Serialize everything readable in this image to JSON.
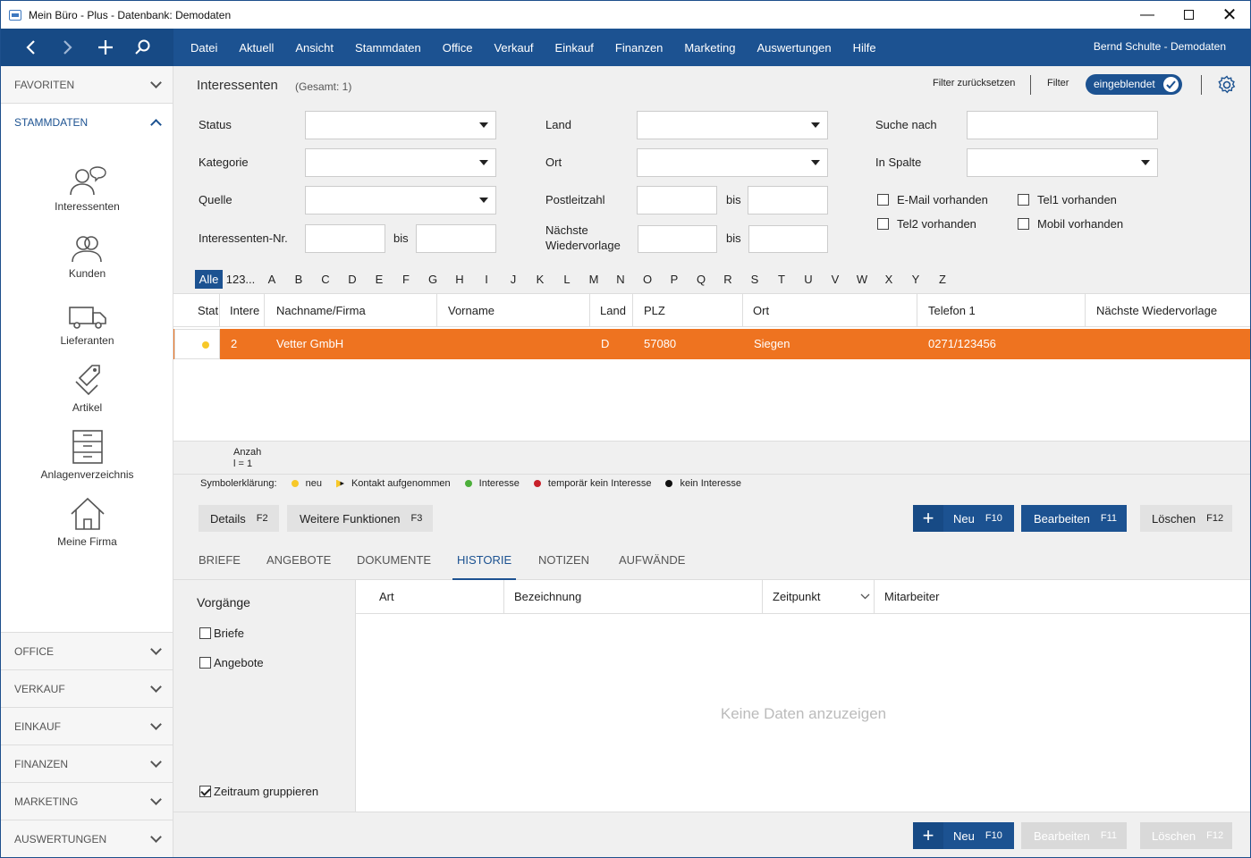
{
  "window": {
    "title": "Mein Büro - Plus - Datenbank: Demodaten"
  },
  "nav": {
    "menus": [
      "Datei",
      "Aktuell",
      "Ansicht",
      "Stammdaten",
      "Office",
      "Verkauf",
      "Einkauf",
      "Finanzen",
      "Marketing",
      "Auswertungen",
      "Hilfe"
    ],
    "user": "Bernd Schulte - Demodaten"
  },
  "sidebar": {
    "favoriten": "FAVORITEN",
    "stammdaten": "STAMMDATEN",
    "items": [
      "Interessenten",
      "Kunden",
      "Lieferanten",
      "Artikel",
      "Anlagenverzeichnis",
      "Meine Firma"
    ],
    "bottom_sections": [
      "OFFICE",
      "VERKAUF",
      "EINKAUF",
      "FINANZEN",
      "MARKETING",
      "AUSWERTUNGEN"
    ]
  },
  "header": {
    "title": "Interessenten",
    "total": "(Gesamt: 1)",
    "reset_filter": "Filter zurücksetzen",
    "filter_label": "Filter",
    "filter_toggle": "eingeblendet"
  },
  "filters": {
    "status": "Status",
    "kategorie": "Kategorie",
    "quelle": "Quelle",
    "nr": "Interessenten-Nr.",
    "bis": "bis",
    "land": "Land",
    "ort": "Ort",
    "plz": "Postleitzahl",
    "wv1": "Nächste",
    "wv2": "Wiedervorlage",
    "suche": "Suche nach",
    "spalte": "In Spalte",
    "email": "E-Mail vorhanden",
    "tel1": "Tel1 vorhanden",
    "tel2": "Tel2 vorhanden",
    "mobil": "Mobil vorhanden"
  },
  "alphabet": [
    "Alle",
    "123...",
    "A",
    "B",
    "C",
    "D",
    "E",
    "F",
    "G",
    "H",
    "I",
    "J",
    "K",
    "L",
    "M",
    "N",
    "O",
    "P",
    "Q",
    "R",
    "S",
    "T",
    "U",
    "V",
    "W",
    "X",
    "Y",
    "Z"
  ],
  "grid": {
    "columns": [
      "Stat",
      "Intere",
      "Nachname/Firma",
      "Vorname",
      "Land",
      "PLZ",
      "Ort",
      "Telefon 1",
      "Nächste Wiedervorlage"
    ],
    "rows": [
      {
        "nr": "2",
        "name": "Vetter GmbH",
        "vorname": "",
        "land": "D",
        "plz": "57080",
        "ort": "Siegen",
        "telefon": "0271/123456",
        "wiedervorlage": ""
      }
    ],
    "count_label_1": "Anzah",
    "count_label_2": "l = 1"
  },
  "legend": {
    "title": "Symbolerklärung:",
    "items": [
      {
        "label": "neu",
        "color": "#f7c829"
      },
      {
        "label": "Kontakt aufgenommen",
        "color": "#f7c829"
      },
      {
        "label": "Interesse",
        "color": "#4caf3a"
      },
      {
        "label": "temporär kein Interesse",
        "color": "#c8202a"
      },
      {
        "label": "kein Interesse",
        "color": "#111111"
      }
    ]
  },
  "actions": {
    "details": "Details",
    "details_key": "F2",
    "weitere": "Weitere Funktionen",
    "weitere_key": "F3",
    "neu": "Neu",
    "neu_key": "F10",
    "bearbeiten": "Bearbeiten",
    "bearbeiten_key": "F11",
    "loeschen": "Löschen",
    "loeschen_key": "F12"
  },
  "tabs": [
    "BRIEFE",
    "ANGEBOTE",
    "DOKUMENTE",
    "HISTORIE",
    "NOTIZEN",
    "AUFWÄNDE"
  ],
  "history": {
    "vorgaenge": "Vorgänge",
    "briefe": "Briefe",
    "angebote": "Angebote",
    "gruppieren": "Zeitraum gruppieren",
    "columns": [
      "Art",
      "Bezeichnung",
      "Zeitpunkt",
      "Mitarbeiter"
    ],
    "empty": "Keine Daten anzuzeigen"
  },
  "colors": {
    "nav": "#1c5291",
    "selected_row": "#ee7320"
  }
}
